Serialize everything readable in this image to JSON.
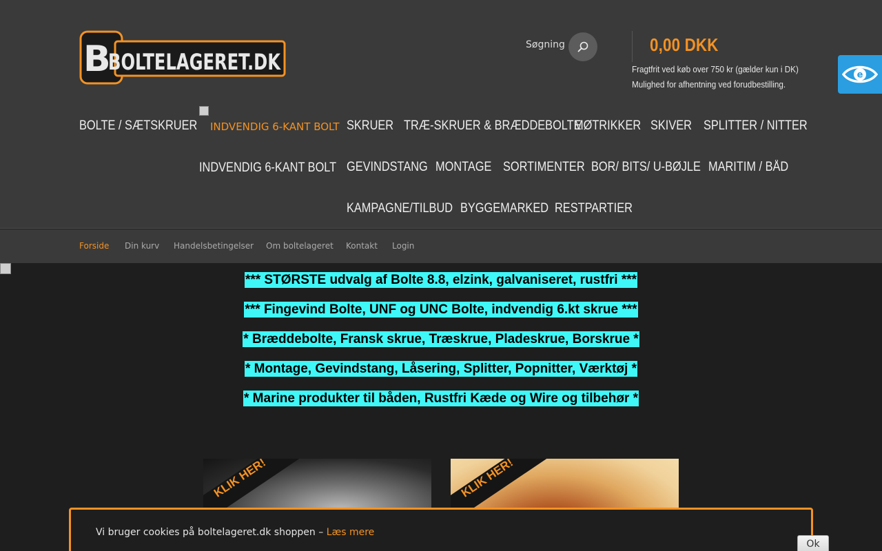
{
  "header": {
    "logo_text": "BOLTELAGERET.DK",
    "search_label": "Søgning",
    "cart_total": "0,00 DKK",
    "shipping_line_1": "Fragtfrit ved køb over 750 kr (gælder kun i DK)",
    "shipping_line_2": "Mulighed for afhentning ved forudbestilling.",
    "accent_color": "#f39224",
    "search_icon": "search-icon",
    "accessibility_icon": "eye-icon"
  },
  "nav": {
    "items": [
      "BOLTE / SÆTSKRUER",
      "INDVENDIG 6-KANT BOLT",
      "SKRUER",
      "TRÆ-SKRUER & BRÆDDEBOLTE",
      "MØTRIKKER",
      "SKIVER",
      "SPLITTER / NITTER",
      "INDVENDIG 6-KANT BOLT",
      "GEVINDSTANG",
      "MONTAGE",
      "SORTIMENTER",
      "BOR/ BITS/ U-BØJLE",
      "MARITIM / BÅD",
      "KAMPAGNE/TILBUD",
      "BYGGEMARKED",
      "RESTPARTIER"
    ]
  },
  "subnav": {
    "items": [
      "Forside",
      "Din kurv",
      "Handelsbetingelser",
      "Om boltelageret",
      "Kontakt",
      "Login"
    ]
  },
  "promo": {
    "lines": [
      "*** STØRSTE udvalg af Bolte 8.8, elzink, galvaniseret, rustfri ***",
      "*** Fingevind Bolte, UNF og UNC Bolte, indvendig 6.kt skrue ***",
      "* Bræddebolte, Fransk skrue, Træskrue, Pladeskrue, Borskrue *",
      "* Montage, Gevindstang, Låsering, Splitter, Popnitter, Værktøj *",
      "* Marine produkter til båden, Rustfri Kæde og Wire og tilbehør *"
    ],
    "highlight_color": "#3ff7f7"
  },
  "banners": {
    "label_1": "KLIK HER!",
    "label_2": "KLIK HER!"
  },
  "cookie": {
    "text": "Vi bruger cookies på boltelageret.dk shoppen – ",
    "link": "Læs mere",
    "ok": "Ok"
  }
}
